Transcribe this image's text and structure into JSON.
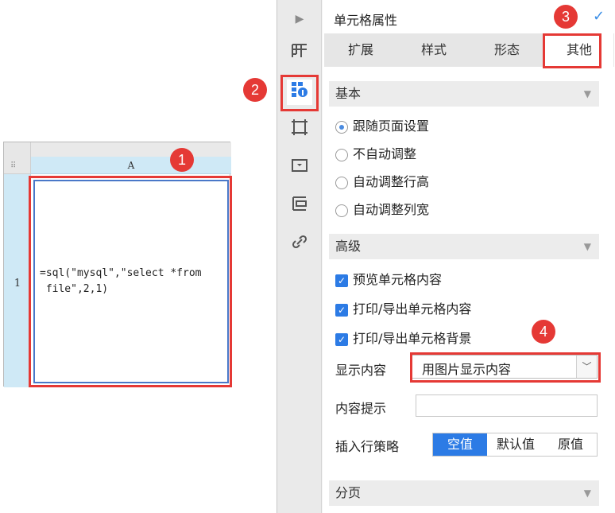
{
  "spreadsheet": {
    "column_header": "A",
    "row_number": "1",
    "cell_formula": "=sql(\"mysql\",\"select *from\n file\",2,1)",
    "corner_grip": "⠿"
  },
  "panel": {
    "title": "单元格属性",
    "pin_icon": "✓",
    "tabs": [
      "扩展",
      "样式",
      "形态",
      "其他"
    ],
    "basic_section": {
      "title": "基本",
      "options": [
        "跟随页面设置",
        "不自动调整",
        "自动调整行高",
        "自动调整列宽"
      ],
      "selected": "跟随页面设置"
    },
    "advanced_section": {
      "title": "高级",
      "checkboxes": [
        "预览单元格内容",
        "打印/导出单元格内容",
        "打印/导出单元格背景"
      ]
    },
    "display_content": {
      "label": "显示内容",
      "value": "用图片显示内容"
    },
    "content_tip": {
      "label": "内容提示",
      "value": ""
    },
    "insert_policy": {
      "label": "插入行策略",
      "options": [
        "空值",
        "默认值",
        "原值"
      ],
      "selected": "空值"
    },
    "paging_section": {
      "title": "分页"
    }
  },
  "badges": [
    "1",
    "2",
    "3",
    "4"
  ],
  "colors": {
    "highlight": "#e53935",
    "accent": "#2c7be5"
  }
}
